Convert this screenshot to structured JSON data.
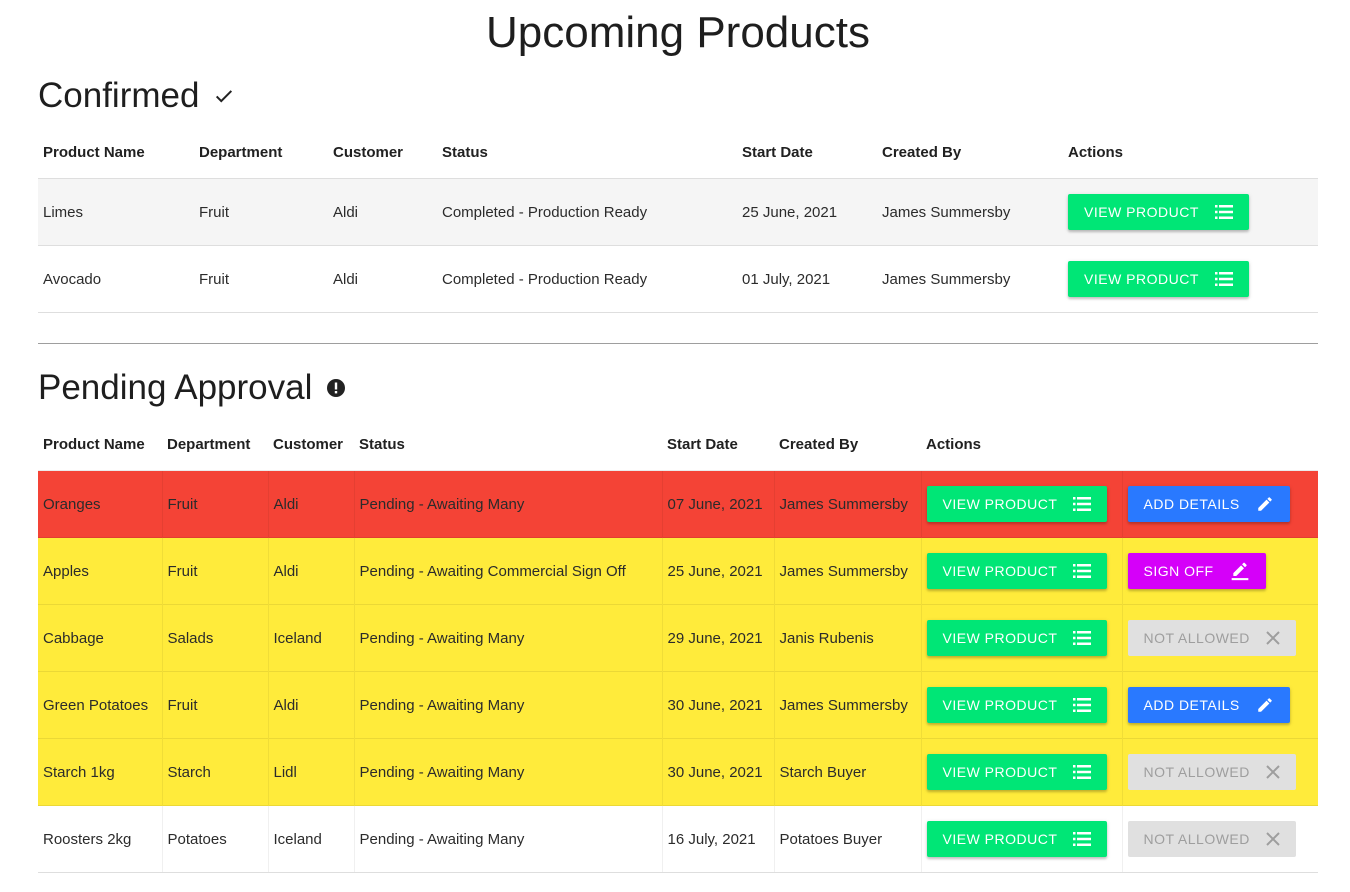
{
  "page": {
    "title": "Upcoming Products"
  },
  "confirmed": {
    "title": "Confirmed",
    "icon": "check-icon",
    "headers": [
      "Product Name",
      "Department",
      "Customer",
      "Status",
      "Start Date",
      "Created By",
      "Actions"
    ],
    "rows": [
      {
        "product": "Limes",
        "department": "Fruit",
        "customer": "Aldi",
        "status": "Completed - Production Ready",
        "start_date": "25 June, 2021",
        "created_by": "James Summersby",
        "action": "VIEW PRODUCT"
      },
      {
        "product": "Avocado",
        "department": "Fruit",
        "customer": "Aldi",
        "status": "Completed - Production Ready",
        "start_date": "01 July, 2021",
        "created_by": "James Summersby",
        "action": "VIEW PRODUCT"
      }
    ]
  },
  "pending": {
    "title": "Pending Approval",
    "icon": "alert-circle-icon",
    "headers": [
      "Product Name",
      "Department",
      "Customer",
      "Status",
      "Start Date",
      "Created By",
      "Actions",
      ""
    ],
    "rows": [
      {
        "product": "Oranges",
        "department": "Fruit",
        "customer": "Aldi",
        "status": "Pending - Awaiting Many",
        "start_date": "07 June, 2021",
        "created_by": "James Summersby",
        "action": "VIEW PRODUCT",
        "secondary": "ADD DETAILS",
        "row_color": "#f44336"
      },
      {
        "product": "Apples",
        "department": "Fruit",
        "customer": "Aldi",
        "status": "Pending - Awaiting Commercial Sign Off",
        "start_date": "25 June, 2021",
        "created_by": "James Summersby",
        "action": "VIEW PRODUCT",
        "secondary": "SIGN OFF",
        "row_color": "#ffeb3b"
      },
      {
        "product": "Cabbage",
        "department": "Salads",
        "customer": "Iceland",
        "status": "Pending - Awaiting Many",
        "start_date": "29 June, 2021",
        "created_by": "Janis Rubenis",
        "action": "VIEW PRODUCT",
        "secondary": "NOT ALLOWED",
        "row_color": "#ffeb3b"
      },
      {
        "product": "Green Potatoes",
        "department": "Fruit",
        "customer": "Aldi",
        "status": "Pending - Awaiting Many",
        "start_date": "30 June, 2021",
        "created_by": "James Summersby",
        "action": "VIEW PRODUCT",
        "secondary": "ADD DETAILS",
        "row_color": "#ffeb3b"
      },
      {
        "product": "Starch 1kg",
        "department": "Starch",
        "customer": "Lidl",
        "status": "Pending - Awaiting Many",
        "start_date": "30 June, 2021",
        "created_by": "Starch Buyer",
        "action": "VIEW PRODUCT",
        "secondary": "NOT ALLOWED",
        "row_color": "#ffeb3b"
      },
      {
        "product": "Roosters 2kg",
        "department": "Potatoes",
        "customer": "Iceland",
        "status": "Pending - Awaiting Many",
        "start_date": "16 July, 2021",
        "created_by": "Potatoes Buyer",
        "action": "VIEW PRODUCT",
        "secondary": "NOT ALLOWED",
        "row_color": "#ffffff"
      }
    ]
  },
  "colors": {
    "view_button": "#00e676",
    "add_details_button": "#2979ff",
    "sign_off_button": "#d500f9",
    "not_allowed_button": "#e0e0e0",
    "overdue_row": "#f44336",
    "warning_row": "#ffeb3b"
  }
}
